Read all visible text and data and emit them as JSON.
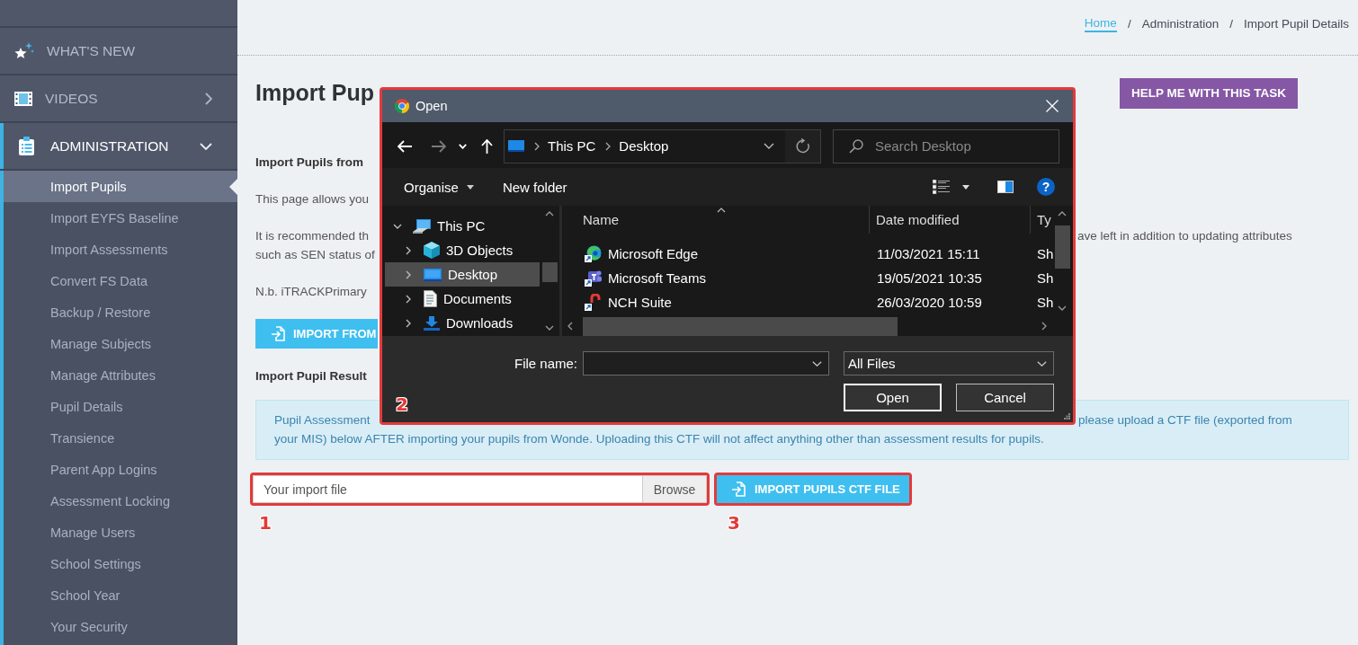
{
  "sidebar": {
    "sections": [
      {
        "kind": "news",
        "label": "WHAT'S NEW",
        "selected": false
      },
      {
        "kind": "videos",
        "label": "VIDEOS",
        "selected": false,
        "expanded": false
      },
      {
        "kind": "admin",
        "label": "ADMINISTRATION",
        "selected": true,
        "expanded": true,
        "children": [
          {
            "label": "Import Pupils",
            "selected": true
          },
          {
            "label": "Import EYFS Baseline",
            "selected": false
          },
          {
            "label": "Import Assessments",
            "selected": false
          },
          {
            "label": "Convert FS Data",
            "selected": false
          },
          {
            "label": "Backup / Restore",
            "selected": false
          },
          {
            "label": "Manage Subjects",
            "selected": false
          },
          {
            "label": "Manage Attributes",
            "selected": false
          },
          {
            "label": "Pupil Details",
            "selected": false
          },
          {
            "label": "Transience",
            "selected": false
          },
          {
            "label": "Parent App Logins",
            "selected": false
          },
          {
            "label": "Assessment Locking",
            "selected": false
          },
          {
            "label": "Manage Users",
            "selected": false
          },
          {
            "label": "School Settings",
            "selected": false
          },
          {
            "label": "School Year",
            "selected": false
          },
          {
            "label": "Your Security",
            "selected": false
          }
        ]
      }
    ]
  },
  "breadcrumb": [
    {
      "kind": "link",
      "label": "Home"
    },
    {
      "kind": "separator",
      "label": "/"
    },
    {
      "kind": "crumb",
      "label": "Administration"
    },
    {
      "kind": "separator",
      "label": "/"
    },
    {
      "kind": "crumb",
      "label": "Import Pupil Details"
    }
  ],
  "page": {
    "title": "Import Pup",
    "help_button": "HELP ME WITH THIS TASK",
    "blocks": [
      {
        "kind": "heading",
        "lines": [
          {
            "left": "Import Pupils from"
          }
        ]
      },
      {
        "kind": "paragraph",
        "lines": [
          {
            "left": "This page allows you"
          }
        ]
      },
      {
        "kind": "paragraph",
        "lines": [
          {
            "left": "It is recommended th",
            "right": "ave left in addition to updating attributes"
          },
          {
            "left": "such as SEN status of"
          }
        ]
      },
      {
        "kind": "paragraph",
        "lines": [
          {
            "left": "N.b. iTRACKPrimary"
          }
        ]
      },
      {
        "kind": "button",
        "label": "IMPORT FROM"
      },
      {
        "kind": "heading",
        "lines": [
          {
            "left": "Import Pupil Result"
          }
        ]
      },
      {
        "kind": "notice",
        "lines": [
          {
            "left": "Pupil Assessment",
            "right": "please upload a CTF file (exported from"
          },
          {
            "left": "your MIS) below AFTER importing your pupils from Wonde. Uploading this CTF will not affect anything other than assessment results for pupils."
          }
        ]
      }
    ]
  },
  "upload": {
    "placeholder": "Your import file",
    "browse": "Browse",
    "highlighted": true,
    "callout": "1"
  },
  "import_button": {
    "label": "IMPORT PUPILS CTF FILE",
    "highlighted": true,
    "callout": "3"
  },
  "dialog": {
    "title": "Open",
    "highlighted": true,
    "callout": "2",
    "address": [
      "This PC",
      "Desktop"
    ],
    "search_placeholder": "Search Desktop",
    "commands": [
      {
        "label": "Organise",
        "menu": true
      },
      {
        "label": "New folder",
        "menu": false
      }
    ],
    "help": "?",
    "nav_tree": [
      {
        "kind": "computer",
        "label": "This PC",
        "expanded": true,
        "selected": false,
        "children": [
          {
            "kind": "objects3d",
            "label": "3D Objects",
            "expanded": false,
            "selected": false
          },
          {
            "kind": "desktop",
            "label": "Desktop",
            "expanded": false,
            "selected": true
          },
          {
            "kind": "documents",
            "label": "Documents",
            "expanded": false,
            "selected": false
          },
          {
            "kind": "downloads",
            "label": "Downloads",
            "expanded": false,
            "selected": false
          }
        ]
      }
    ],
    "columns": [
      {
        "label": "Name",
        "sorted": true
      },
      {
        "label": "Date modified",
        "sorted": false
      },
      {
        "label": "Ty",
        "sorted": false
      }
    ],
    "files": [
      {
        "kind": "browser",
        "name": "Microsoft Edge",
        "date": "11/03/2021 15:11",
        "type": "Sh"
      },
      {
        "kind": "chat",
        "name": "Microsoft Teams",
        "date": "19/05/2021 10:35",
        "type": "Sh"
      },
      {
        "kind": "suite",
        "name": "NCH Suite",
        "date": "26/03/2020 10:59",
        "type": "Sh"
      }
    ],
    "file_name_label": "File name:",
    "filter": "All Files",
    "buttons": [
      {
        "label": "Open",
        "default": true
      },
      {
        "label": "Cancel",
        "default": false
      }
    ]
  }
}
